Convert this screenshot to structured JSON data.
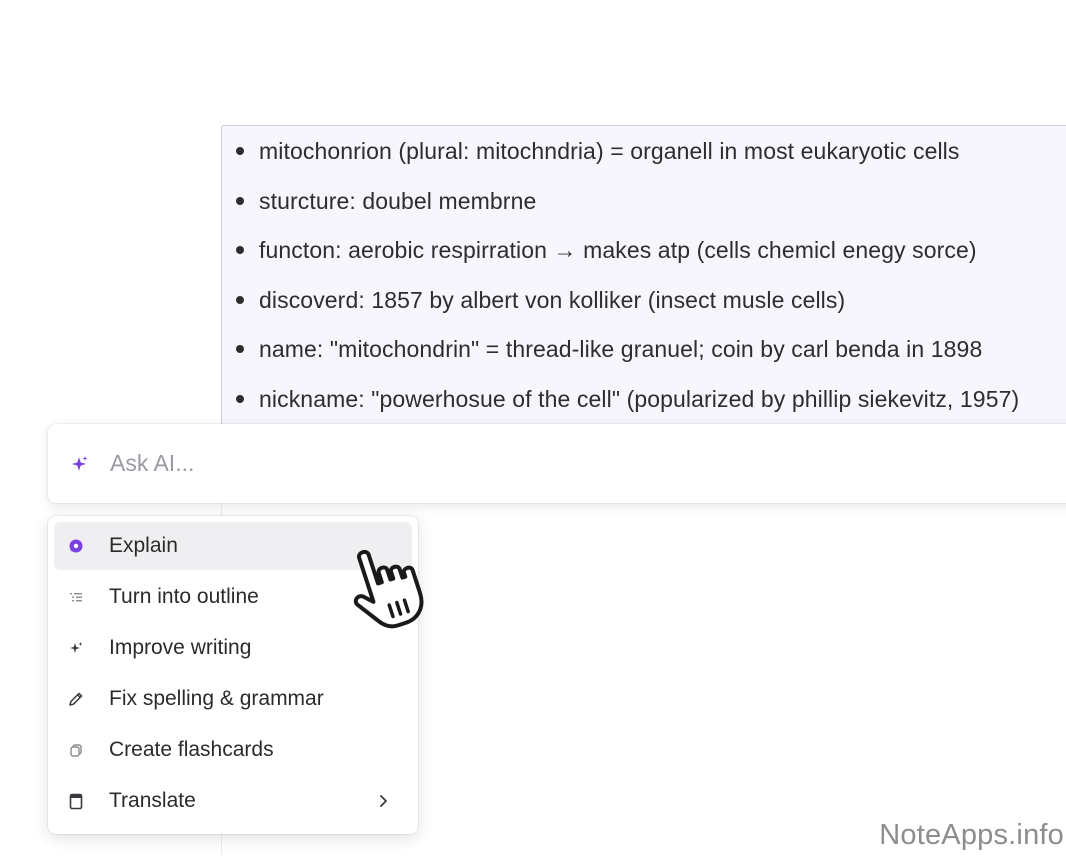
{
  "note": {
    "bullets": [
      "mitochonrion (plural: mitochndria) = organell in most eukaryotic cells",
      "sturcture: doubel membrne",
      "functon: aerobic respirration → makes atp (cells chemicl enegy sorce)",
      "discoverd: 1857 by albert von kolliker (insect musle cells)",
      "name: \"mitochondrin\" = thread-like granuel; coin by carl benda in 1898",
      "nickname: \"powerhosue of the cell\" (popularized by phillip siekevitz, 1957)"
    ]
  },
  "ask_ai": {
    "placeholder": "Ask AI...",
    "icon": "sparkle-icon"
  },
  "menu": {
    "items": [
      {
        "label": "Explain",
        "icon": "explain-bubble-icon",
        "active": true
      },
      {
        "label": "Turn into outline",
        "icon": "outline-list-icon"
      },
      {
        "label": "Improve writing",
        "icon": "sparkle-icon"
      },
      {
        "label": "Fix spelling & grammar",
        "icon": "pencil-icon"
      },
      {
        "label": "Create flashcards",
        "icon": "flashcards-icon"
      },
      {
        "label": "Translate",
        "icon": "book-icon",
        "has_submenu": true
      }
    ]
  },
  "colors": {
    "accent": "#7b3fe4",
    "selection_bg": "#f7f6fc",
    "selection_border": "#cfcde6",
    "menu_active_bg": "#efeff1"
  },
  "watermark": "NoteApps.info"
}
